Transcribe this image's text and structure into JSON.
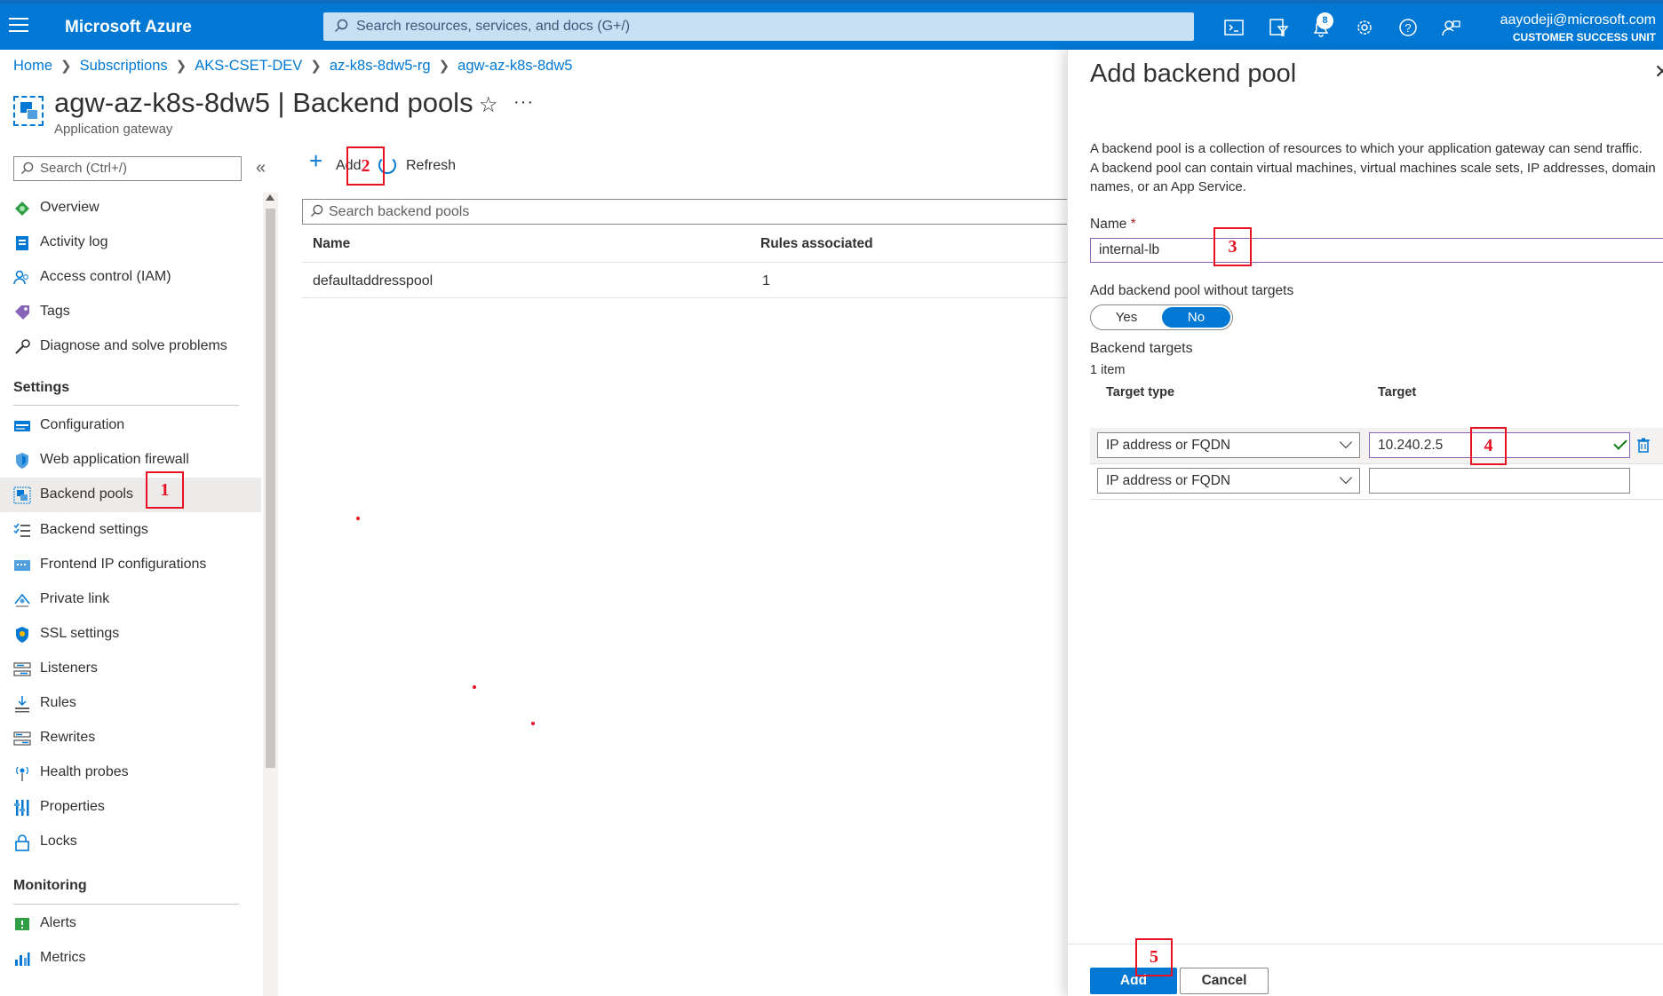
{
  "topbar": {
    "brand": "Microsoft Azure",
    "search_placeholder": "Search resources, services, and docs (G+/)",
    "notifications_count": "8",
    "account_email": "aayodeji@microsoft.com",
    "account_unit": "CUSTOMER SUCCESS UNIT",
    "icons": [
      "menu-icon",
      "cloud-shell-icon",
      "directory-filter-icon",
      "notifications-icon",
      "settings-icon",
      "help-icon",
      "feedback-icon"
    ]
  },
  "breadcrumb": [
    "Home",
    "Subscriptions",
    "AKS-CSET-DEV",
    "az-k8s-8dw5-rg",
    "agw-az-k8s-8dw5"
  ],
  "page": {
    "title": "agw-az-k8s-8dw5 | Backend pools",
    "subtitle": "Application gateway"
  },
  "sidebar": {
    "search_placeholder": "Search (Ctrl+/)",
    "items": [
      {
        "label": "Overview",
        "icon": "overview-icon"
      },
      {
        "label": "Activity log",
        "icon": "activity-log-icon"
      },
      {
        "label": "Access control (IAM)",
        "icon": "iam-icon"
      },
      {
        "label": "Tags",
        "icon": "tag-icon"
      },
      {
        "label": "Diagnose and solve problems",
        "icon": "wrench-icon"
      }
    ],
    "settings_header": "Settings",
    "settings_items": [
      {
        "label": "Configuration",
        "icon": "configuration-icon"
      },
      {
        "label": "Web application firewall",
        "icon": "shield-icon"
      },
      {
        "label": "Backend pools",
        "icon": "backend-pools-icon",
        "active": true
      },
      {
        "label": "Backend settings",
        "icon": "list-settings-icon"
      },
      {
        "label": "Frontend IP configurations",
        "icon": "frontend-ip-icon"
      },
      {
        "label": "Private link",
        "icon": "private-link-icon"
      },
      {
        "label": "SSL settings",
        "icon": "ssl-shield-icon"
      },
      {
        "label": "Listeners",
        "icon": "listeners-icon"
      },
      {
        "label": "Rules",
        "icon": "rules-icon"
      },
      {
        "label": "Rewrites",
        "icon": "rewrites-icon"
      },
      {
        "label": "Health probes",
        "icon": "health-probe-icon"
      },
      {
        "label": "Properties",
        "icon": "properties-icon"
      },
      {
        "label": "Locks",
        "icon": "lock-icon"
      }
    ],
    "monitoring_header": "Monitoring",
    "monitoring_items": [
      {
        "label": "Alerts",
        "icon": "alert-icon"
      },
      {
        "label": "Metrics",
        "icon": "metrics-icon"
      }
    ]
  },
  "main": {
    "add_label": "Add",
    "refresh_label": "Refresh",
    "search_placeholder": "Search backend pools",
    "columns": [
      "Name",
      "Rules associated"
    ],
    "rows": [
      {
        "name": "defaultaddresspool",
        "rules": "1"
      }
    ]
  },
  "blade": {
    "title": "Add backend pool",
    "description_1": "A backend pool is a collection of resources to which your application gateway can send traffic.",
    "description_2": "A backend pool can contain virtual machines, virtual machines scale sets, IP addresses, domain",
    "description_3": "names, or an App Service.",
    "name_label": "Name",
    "name_required": "*",
    "name_value": "internal-lb",
    "without_targets_label": "Add backend pool without targets",
    "toggle_yes": "Yes",
    "toggle_no": "No",
    "toggle_selected": "No",
    "targets_header": "Backend targets",
    "targets_count": "1 item",
    "targets_columns": [
      "Target type",
      "Target"
    ],
    "targets": [
      {
        "type": "IP address or FQDN",
        "target": "10.240.2.5"
      },
      {
        "type": "IP address or FQDN",
        "target": ""
      }
    ],
    "add_button": "Add",
    "cancel_button": "Cancel"
  },
  "annotations": [
    "1",
    "2",
    "3",
    "4",
    "5"
  ],
  "colors": {
    "accent": "#0078d4",
    "callout": "#e81123",
    "nav_active": "#edebe9"
  }
}
